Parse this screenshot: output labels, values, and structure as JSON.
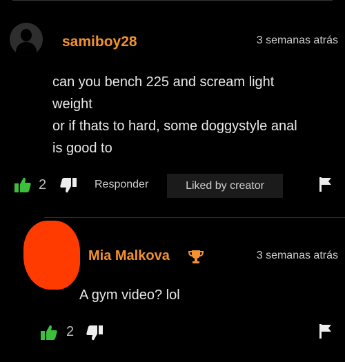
{
  "comments": [
    {
      "username": "samiboy28",
      "time": "3 semanas atrás",
      "text_lines": [
        "can you bench 225 and scream light",
        "weight",
        "or if thats to hard, some doggystyle anal",
        "is good to"
      ],
      "votes": "2",
      "reply_label": "Responder",
      "liked_label": "Liked by creator"
    },
    {
      "username": "Mia Malkova",
      "time": "3 semanas atrás",
      "text": "A gym video? lol",
      "votes": "2"
    }
  ],
  "icons": [
    "thumbs-up-icon",
    "thumbs-down-icon",
    "flag-icon",
    "trophy-icon",
    "avatar-placeholder-icon"
  ],
  "colors": {
    "background": "#000000",
    "username": "#f3922f",
    "thumbs_up": "#3dbf3d",
    "text": "#e9e9e9",
    "muted": "#cfcfcf",
    "button_bg": "#1b1b1b"
  }
}
